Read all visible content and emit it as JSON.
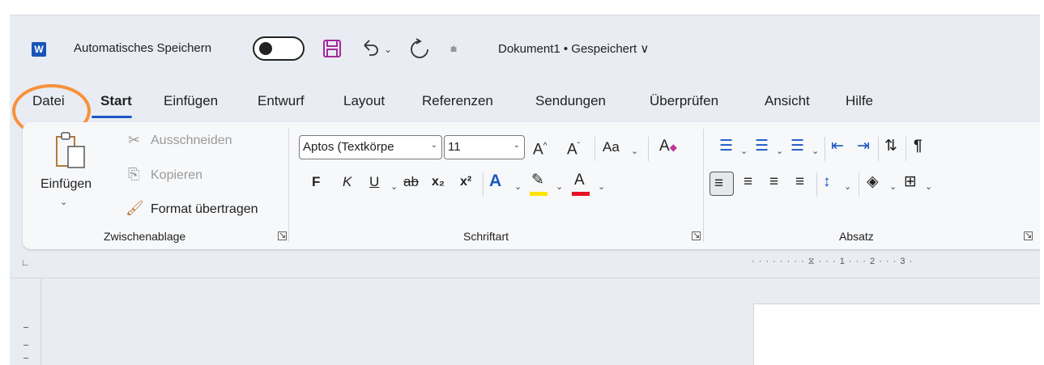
{
  "titlebar": {
    "app_logo": "W",
    "autosave_label": "Automatisches Speichern",
    "autosave_state": "off",
    "doc_title": "Dokument1 • Gespeichert ∨"
  },
  "tabs": [
    {
      "label": "Datei"
    },
    {
      "label": "Start",
      "active": true
    },
    {
      "label": "Einfügen"
    },
    {
      "label": "Entwurf"
    },
    {
      "label": "Layout"
    },
    {
      "label": "Referenzen"
    },
    {
      "label": "Sendungen"
    },
    {
      "label": "Überprüfen"
    },
    {
      "label": "Ansicht"
    },
    {
      "label": "Hilfe"
    }
  ],
  "clipboard": {
    "paste_label": "Einfügen",
    "cut_label": "Ausschneiden",
    "copy_label": "Kopieren",
    "format_painter_label": "Format übertragen",
    "group_label": "Zwischenablage"
  },
  "font": {
    "font_name": "Aptos (Textkörpe",
    "font_size": "11",
    "bold_label": "F",
    "italic_label": "K",
    "underline_label": "U",
    "strike_label": "ab",
    "subscript_label": "x₂",
    "superscript_label": "x²",
    "change_case_label": "Aa",
    "group_label": "Schriftart"
  },
  "paragraph": {
    "group_label": "Absatz",
    "show_marks_label": "¶"
  },
  "ruler": {
    "text": "· · · · · · · · ⧖ · · · 1 · · · 2 · · · 3 ·"
  },
  "colors": {
    "accent": "#1a57c4",
    "highlight_annotation": "#f7913c",
    "save_icon": "#a6289c",
    "highlight_yellow": "#ffe400",
    "font_color_red": "#e81123"
  }
}
